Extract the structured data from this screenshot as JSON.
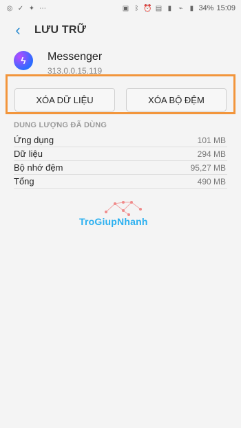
{
  "status": {
    "battery": "34%",
    "time": "15:09"
  },
  "header": {
    "title": "LƯU TRỮ"
  },
  "app": {
    "name": "Messenger",
    "version": "313.0.0.15.119"
  },
  "actions": {
    "clear_data": "XÓA DỮ LIỆU",
    "clear_cache": "XÓA BỘ ĐỆM"
  },
  "usage": {
    "section_title": "DUNG LƯỢNG ĐÃ DÙNG",
    "rows": [
      {
        "label": "Ứng dụng",
        "value": "101 MB"
      },
      {
        "label": "Dữ liệu",
        "value": "294 MB"
      },
      {
        "label": "Bộ nhớ đệm",
        "value": "95,27 MB"
      },
      {
        "label": "Tổng",
        "value": "490 MB"
      }
    ]
  },
  "watermark": {
    "text": "TroGiupNhanh"
  },
  "colors": {
    "accent": "#2a8bd0",
    "highlight": "#f2953b",
    "watermark": "#2bb0f0"
  }
}
